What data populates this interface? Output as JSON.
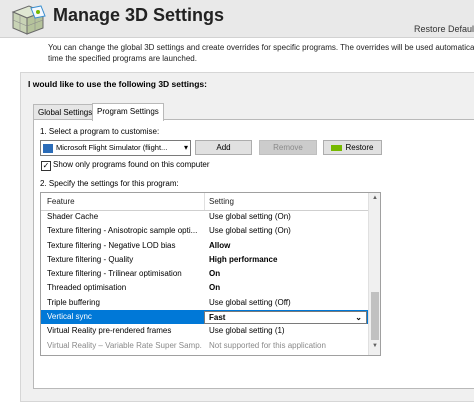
{
  "header": {
    "title": "Manage 3D Settings",
    "restore_link": "Restore Defaults",
    "intro_line1": "You can change the global 3D settings and create overrides for specific programs. The overrides will be used automatically each",
    "intro_line2": "time the specified programs are launched."
  },
  "section": {
    "label": "I would like to use the following 3D settings:"
  },
  "tabs": [
    {
      "label": "Global Settings",
      "active": false
    },
    {
      "label": "Program Settings",
      "active": true
    }
  ],
  "program": {
    "step1": "1. Select a program to customise:",
    "selected": "Microsoft Flight Simulator (flight...",
    "add_label": "Add",
    "remove_label": "Remove",
    "restore_label": "Restore",
    "show_only_label": "Show only programs found on this computer",
    "show_only_checked": true,
    "step2": "2. Specify the settings for this program:"
  },
  "table": {
    "headers": {
      "feature": "Feature",
      "setting": "Setting"
    },
    "rows": [
      {
        "feature": "Shader Cache",
        "setting": "Use global setting (On)",
        "bold": false,
        "selected": false,
        "disabled": false
      },
      {
        "feature": "Texture filtering - Anisotropic sample opti...",
        "setting": "Use global setting (On)",
        "bold": false,
        "selected": false,
        "disabled": false
      },
      {
        "feature": "Texture filtering - Negative LOD bias",
        "setting": "Allow",
        "bold": true,
        "selected": false,
        "disabled": false
      },
      {
        "feature": "Texture filtering - Quality",
        "setting": "High performance",
        "bold": true,
        "selected": false,
        "disabled": false
      },
      {
        "feature": "Texture filtering - Trilinear optimisation",
        "setting": "On",
        "bold": true,
        "selected": false,
        "disabled": false
      },
      {
        "feature": "Threaded optimisation",
        "setting": "On",
        "bold": true,
        "selected": false,
        "disabled": false
      },
      {
        "feature": "Triple buffering",
        "setting": "Use global setting (Off)",
        "bold": false,
        "selected": false,
        "disabled": false
      },
      {
        "feature": "Vertical sync",
        "setting": "Fast",
        "bold": true,
        "selected": true,
        "disabled": false
      },
      {
        "feature": "Virtual Reality pre-rendered frames",
        "setting": "Use global setting (1)",
        "bold": false,
        "selected": false,
        "disabled": false
      },
      {
        "feature": "Virtual Reality – Variable Rate Super Samp...",
        "setting": "Not supported for this application",
        "bold": false,
        "selected": false,
        "disabled": true
      }
    ]
  },
  "colors": {
    "selection": "#0078d7",
    "nvidia_green": "#76b900"
  }
}
